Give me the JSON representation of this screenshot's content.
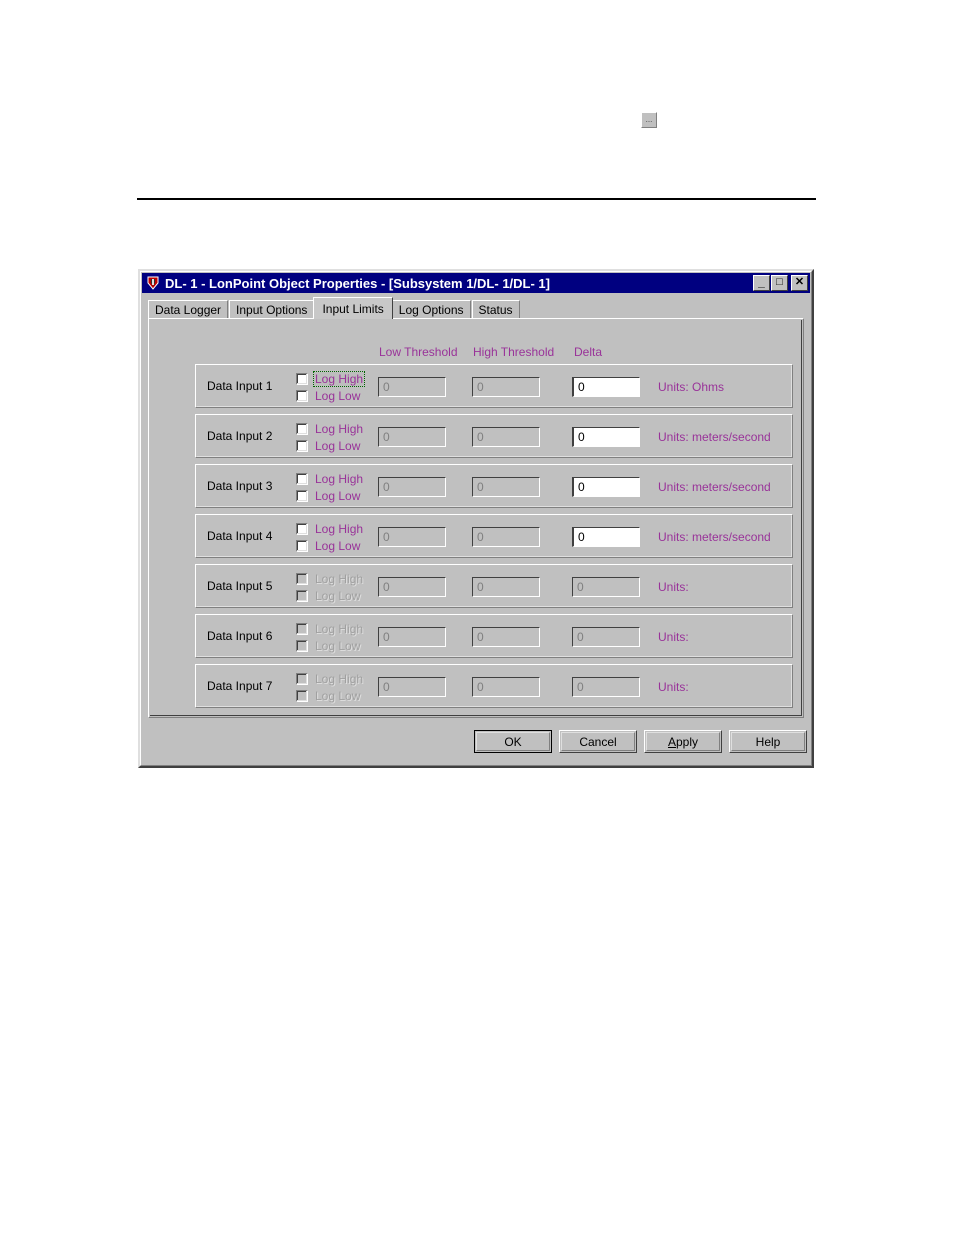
{
  "page": {
    "ellipsis_button_label": "...",
    "ellipsis_icon": "ellipsis-button-icon"
  },
  "window": {
    "title": "DL- 1 - LonPoint Object Properties - [Subsystem 1/DL- 1/DL- 1]",
    "icon": "lonpoint-shield-icon",
    "controls": {
      "minimize": "_",
      "maximize": "□",
      "close": "✕"
    }
  },
  "tabs": [
    {
      "label": "Data Logger",
      "selected": false
    },
    {
      "label": "Input Options",
      "selected": false
    },
    {
      "label": "Input Limits",
      "selected": true
    },
    {
      "label": "Log Options",
      "selected": false
    },
    {
      "label": "Status",
      "selected": false
    }
  ],
  "columns": {
    "low_threshold": "Low Threshold",
    "high_threshold": "High Threshold",
    "delta": "Delta"
  },
  "labels": {
    "log_high": "Log High",
    "log_low": "Log Low",
    "units_prefix": "Units:"
  },
  "rows": [
    {
      "label": "Data Input 1",
      "enabled": true,
      "log_high_checked": false,
      "log_low_checked": false,
      "log_high_focused": true,
      "low_threshold": "0",
      "high_threshold": "0",
      "delta": "0",
      "delta_enabled": true,
      "units": "Units: Ohms"
    },
    {
      "label": "Data Input 2",
      "enabled": true,
      "log_high_checked": false,
      "log_low_checked": false,
      "log_high_focused": false,
      "low_threshold": "0",
      "high_threshold": "0",
      "delta": "0",
      "delta_enabled": true,
      "units": "Units: meters/second"
    },
    {
      "label": "Data Input 3",
      "enabled": true,
      "log_high_checked": false,
      "log_low_checked": false,
      "log_high_focused": false,
      "low_threshold": "0",
      "high_threshold": "0",
      "delta": "0",
      "delta_enabled": true,
      "units": "Units: meters/second"
    },
    {
      "label": "Data Input 4",
      "enabled": true,
      "log_high_checked": false,
      "log_low_checked": false,
      "log_high_focused": false,
      "low_threshold": "0",
      "high_threshold": "0",
      "delta": "0",
      "delta_enabled": true,
      "units": "Units: meters/second"
    },
    {
      "label": "Data Input 5",
      "enabled": false,
      "log_high_checked": false,
      "log_low_checked": false,
      "log_high_focused": false,
      "low_threshold": "0",
      "high_threshold": "0",
      "delta": "0",
      "delta_enabled": false,
      "units": "Units:"
    },
    {
      "label": "Data Input 6",
      "enabled": false,
      "log_high_checked": false,
      "log_low_checked": false,
      "log_high_focused": false,
      "low_threshold": "0",
      "high_threshold": "0",
      "delta": "0",
      "delta_enabled": false,
      "units": "Units:"
    },
    {
      "label": "Data Input 7",
      "enabled": false,
      "log_high_checked": false,
      "log_low_checked": false,
      "log_high_focused": false,
      "low_threshold": "0",
      "high_threshold": "0",
      "delta": "0",
      "delta_enabled": false,
      "units": "Units:"
    }
  ],
  "buttons": {
    "ok": "OK",
    "cancel": "Cancel",
    "apply": "Apply",
    "apply_mnemonic": "A",
    "apply_rest": "pply",
    "help": "Help"
  },
  "colors": {
    "titlebar": "#000080",
    "face": "#c0c0c0",
    "accent_purple": "#993399",
    "disabled_text": "#a0a0a0",
    "focus_outline": "#006400"
  }
}
